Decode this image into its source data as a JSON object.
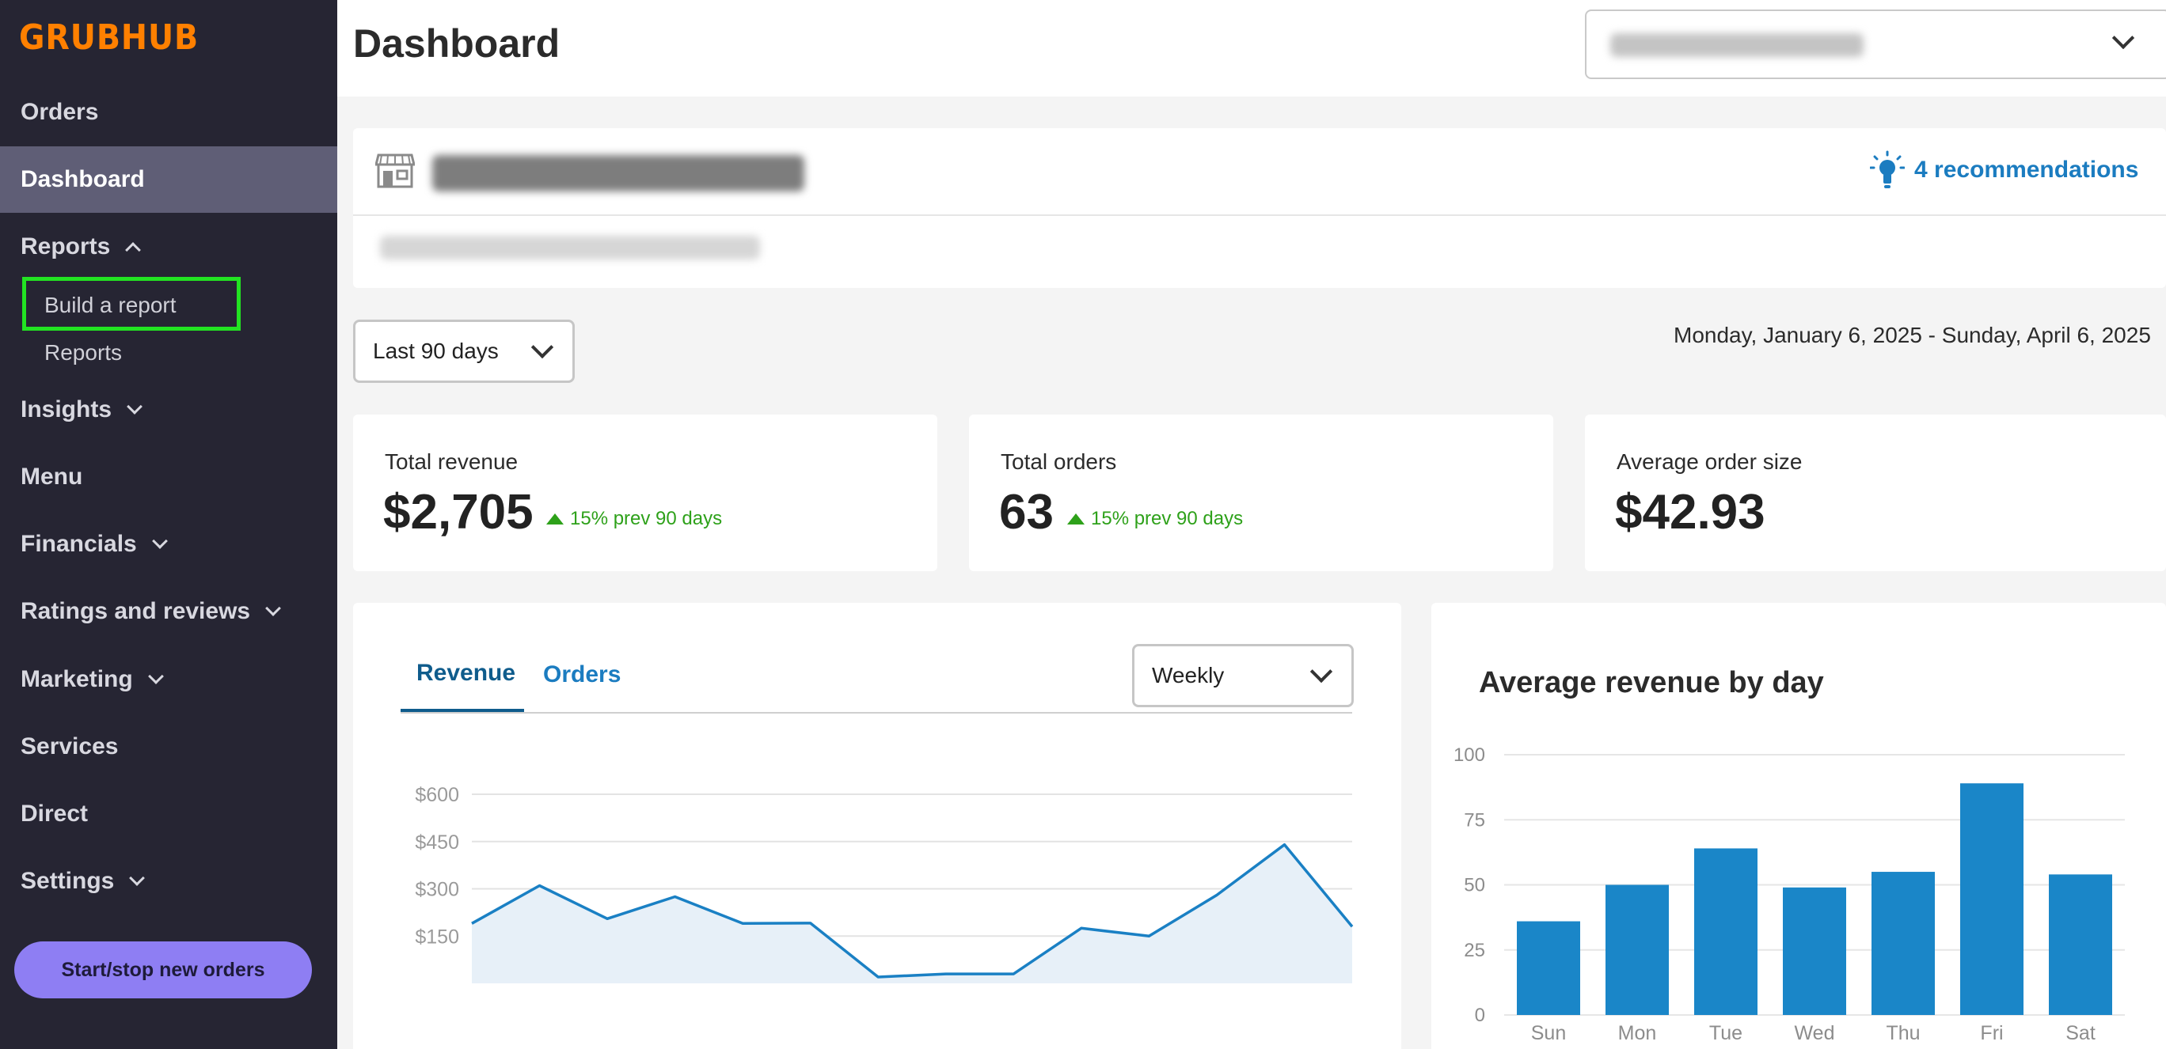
{
  "brand": {
    "logo": "GRUBHUB"
  },
  "sidebar": {
    "items": [
      {
        "label": "Orders"
      },
      {
        "label": "Dashboard"
      },
      {
        "label": "Reports"
      },
      {
        "label": "Insights"
      },
      {
        "label": "Menu"
      },
      {
        "label": "Financials"
      },
      {
        "label": "Ratings and reviews"
      },
      {
        "label": "Marketing"
      },
      {
        "label": "Services"
      },
      {
        "label": "Direct"
      },
      {
        "label": "Settings"
      }
    ],
    "reports_sub": [
      {
        "label": "Build a report"
      },
      {
        "label": "Reports"
      }
    ],
    "start_button": "Start/stop new orders"
  },
  "header": {
    "title": "Dashboard"
  },
  "restaurant": {
    "recommendations": "4 recommendations"
  },
  "filters": {
    "period": "Last 90 days",
    "date_range": "Monday, January 6, 2025 - Sunday, April 6, 2025"
  },
  "stats": [
    {
      "label": "Total revenue",
      "value": "$2,705",
      "delta": "15% prev 90 days"
    },
    {
      "label": "Total orders",
      "value": "63",
      "delta": "15% prev 90 days"
    },
    {
      "label": "Average order size",
      "value": "$42.93"
    }
  ],
  "revenue_card": {
    "tabs": [
      {
        "label": "Revenue"
      },
      {
        "label": "Orders"
      }
    ],
    "interval": "Weekly"
  },
  "bar_card": {
    "title": "Average revenue by day"
  },
  "colors": {
    "brand": "#ff8000",
    "sidebar": "#262533",
    "accent": "#1b7cc0",
    "positive": "#2ea11a",
    "bar": "#1a86c8",
    "line": "#1a80c4"
  },
  "chart_data": [
    {
      "type": "area",
      "title": "",
      "xlabel": "",
      "ylabel": "",
      "yticks": [
        "$600",
        "$450",
        "$300",
        "$150"
      ],
      "ylim": [
        0,
        600
      ],
      "x": [
        1,
        2,
        3,
        4,
        5,
        6,
        7,
        8,
        9,
        10,
        11,
        12,
        13,
        14
      ],
      "series": [
        {
          "values": [
            190,
            310,
            205,
            275,
            190,
            191,
            20,
            30,
            30,
            175,
            150,
            280,
            440,
            180
          ]
        }
      ],
      "grid": true
    },
    {
      "type": "bar",
      "title": "Average revenue by day",
      "categories": [
        "Sun",
        "Mon",
        "Tue",
        "Wed",
        "Thu",
        "Fri",
        "Sat"
      ],
      "values": [
        36,
        50,
        64,
        49,
        55,
        89,
        54
      ],
      "ylim": [
        0,
        100
      ],
      "yticks": [
        "0",
        "25",
        "50",
        "75",
        "100"
      ],
      "grid": true
    }
  ]
}
